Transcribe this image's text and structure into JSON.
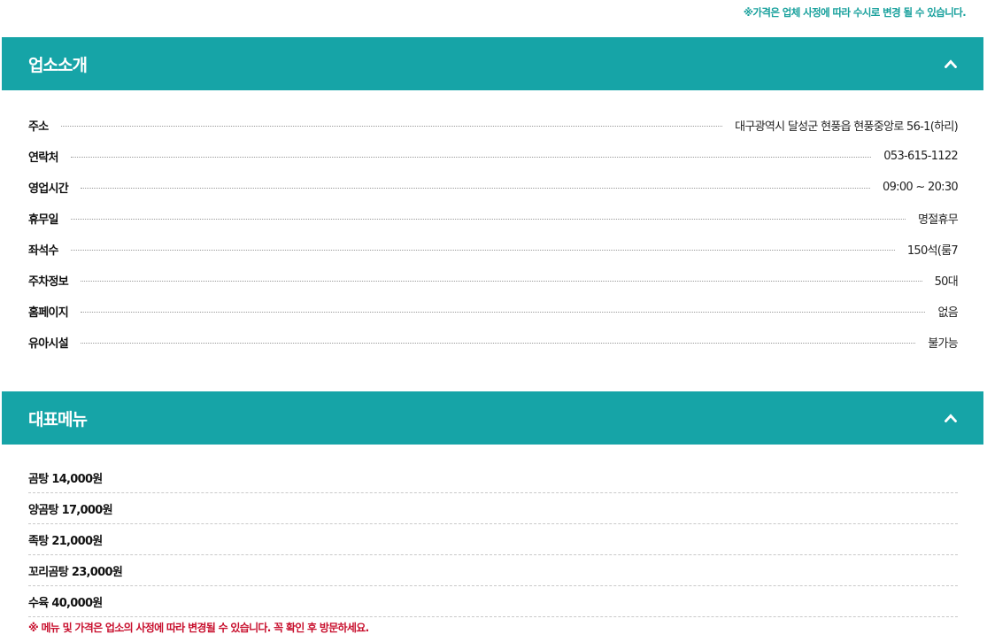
{
  "price_note": "※가격은 업체 사정에 따라 수시로 변경 될 수 있습니다.",
  "intro": {
    "title": "업소소개",
    "rows": [
      {
        "label": "주소",
        "value": "대구광역시 달성군 현풍읍 현풍중앙로 56-1(하리)"
      },
      {
        "label": "연락처",
        "value": "053-615-1122"
      },
      {
        "label": "영업시간",
        "value": "09:00 ~ 20:30"
      },
      {
        "label": "휴무일",
        "value": "명절휴무"
      },
      {
        "label": "좌석수",
        "value": "150석(룸7"
      },
      {
        "label": "주차정보",
        "value": "50대"
      },
      {
        "label": "홈페이지",
        "value": "없음"
      },
      {
        "label": "유아시설",
        "value": "불가능"
      }
    ]
  },
  "menu": {
    "title": "대표메뉴",
    "items": [
      "곰탕 14,000원",
      "양곰탕 17,000원",
      "족탕 21,000원",
      "꼬리곰탕 23,000원",
      "수육 40,000원"
    ],
    "note": "※ 메뉴 및 가격은 업소의 사정에 따라 변경될 수 있습니다. 꼭 확인 후 방문하세요."
  },
  "colors": {
    "header_bg": "#16a4a7",
    "accent_text": "#17a09c",
    "warning_text": "#c8102e"
  },
  "icons": {
    "collapse": "chevron-up-icon"
  }
}
